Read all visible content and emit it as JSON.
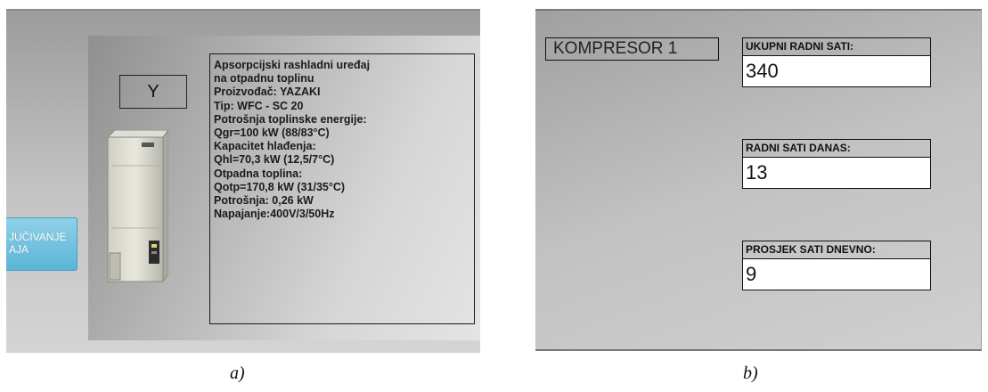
{
  "panel_a": {
    "side_button": {
      "line1": "JUČIVANJE",
      "line2": "AJA"
    },
    "unit_label": "Y",
    "info_lines": [
      "Apsorpcijski rashladni uređaj",
      "na otpadnu toplinu",
      "Proizvođač: YAZAKI",
      "Tip: WFC - SC 20",
      "Potrošnja toplinske energije:",
      "Qgr=100 kW (88/83°C)",
      "Kapacitet hlađenja:",
      "Qhl=70,3 kW (12,5/7°C)",
      "Otpadna toplina:",
      "Qotp=170,8 kW (31/35°C)",
      "Potrošnja: 0,26 kW",
      "Napajanje:400V/3/50Hz"
    ],
    "caption": "a)"
  },
  "panel_b": {
    "title": "KOMPRESOR 1",
    "stats": [
      {
        "label": "UKUPNI RADNI SATI:",
        "value": "340"
      },
      {
        "label": "RADNI SATI DANAS:",
        "value": "13"
      },
      {
        "label": "PROSJEK SATI DNEVNO:",
        "value": "9"
      }
    ],
    "caption": "b)"
  },
  "colors": {
    "button_accent": "#5bb5d6",
    "panel_gray": "#b8b8b8",
    "value_field_bg": "#ffffff"
  }
}
